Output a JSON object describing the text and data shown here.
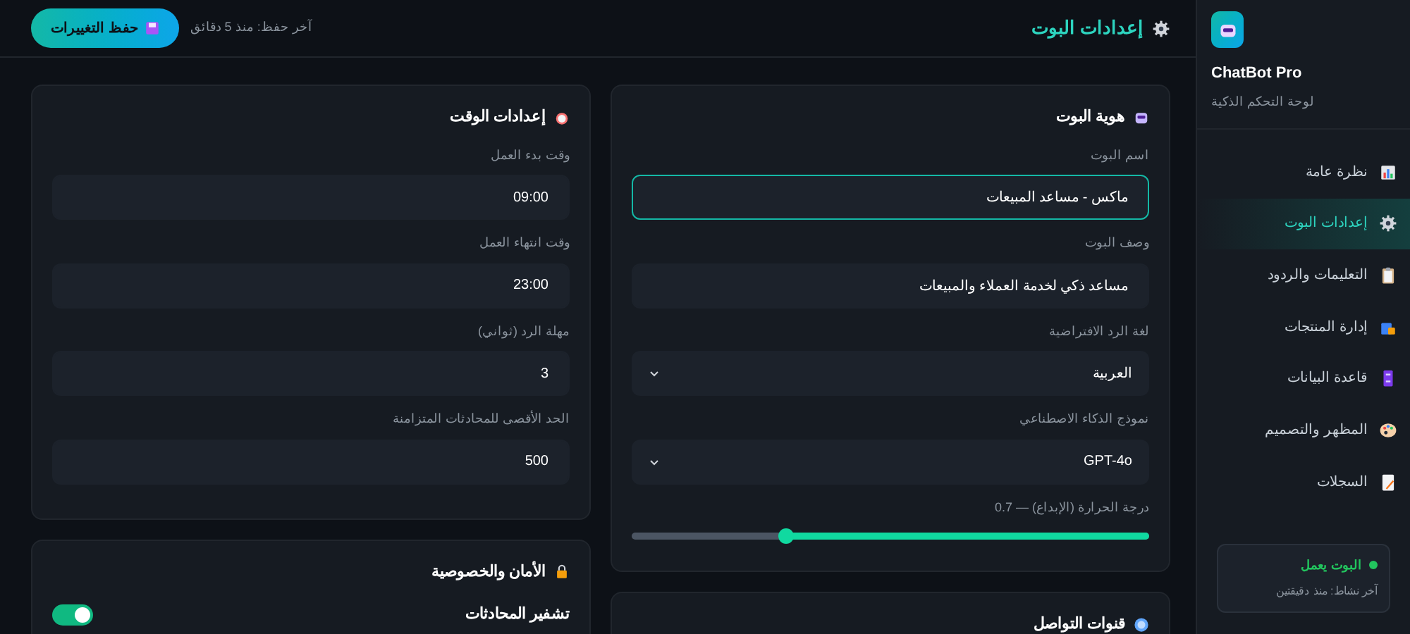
{
  "header": {
    "title": "إعدادات البوت",
    "last_saved": "آخر حفظ: منذ 5 دقائق",
    "save_button": "حفظ التغييرات"
  },
  "sidebar": {
    "brand": "ChatBot Pro",
    "subtitle": "لوحة التحكم الذكية",
    "items": [
      {
        "label": "نظرة عامة",
        "selected": false
      },
      {
        "label": "إعدادات البوت",
        "selected": true
      },
      {
        "label": "التعليمات والردود",
        "selected": false
      },
      {
        "label": "إدارة المنتجات",
        "selected": false
      },
      {
        "label": "قاعدة البيانات",
        "selected": false
      },
      {
        "label": "المظهر والتصميم",
        "selected": false
      },
      {
        "label": "السجلات",
        "selected": false
      }
    ],
    "status": {
      "label": "البوت يعمل",
      "detail": "آخر نشاط: منذ دقيقتين",
      "online": true
    }
  },
  "columns": [
    [
      {
        "title": "هوية البوت",
        "fields": [
          {
            "kind": "text",
            "label": "اسم البوت",
            "value": "ماكس - مساعد المبيعات",
            "focused": true
          },
          {
            "kind": "text",
            "label": "وصف البوت",
            "value": "مساعد ذكي لخدمة العملاء والمبيعات",
            "focused": false
          },
          {
            "kind": "select",
            "label": "لغة الرد الافتراضية",
            "value": "العربية"
          },
          {
            "kind": "select",
            "label": "نموذج الذكاء الاصطناعي",
            "value": "GPT-4o"
          },
          {
            "kind": "slider",
            "label": "درجة الحرارة (الإبداع) — 0.7",
            "level": 0.7
          }
        ]
      },
      {
        "title": "قنوات التواصل"
      }
    ],
    [
      {
        "title": "إعدادات الوقت",
        "fields": [
          {
            "kind": "text",
            "label": "وقت بدء العمل",
            "value": "09:00",
            "focused": false
          },
          {
            "kind": "text",
            "label": "وقت انتهاء العمل",
            "value": "23:00",
            "focused": false
          },
          {
            "kind": "text",
            "label": "مهلة الرد (ثواني)",
            "value": "3",
            "focused": false
          },
          {
            "kind": "text",
            "label": "الحد الأقصى للمحادثات المتزامنة",
            "value": "500",
            "focused": false
          }
        ]
      },
      {
        "title": "الأمان والخصوصية",
        "fields": [
          {
            "kind": "toggle",
            "label": "تشفير المحادثات",
            "on": true
          }
        ]
      }
    ]
  ]
}
